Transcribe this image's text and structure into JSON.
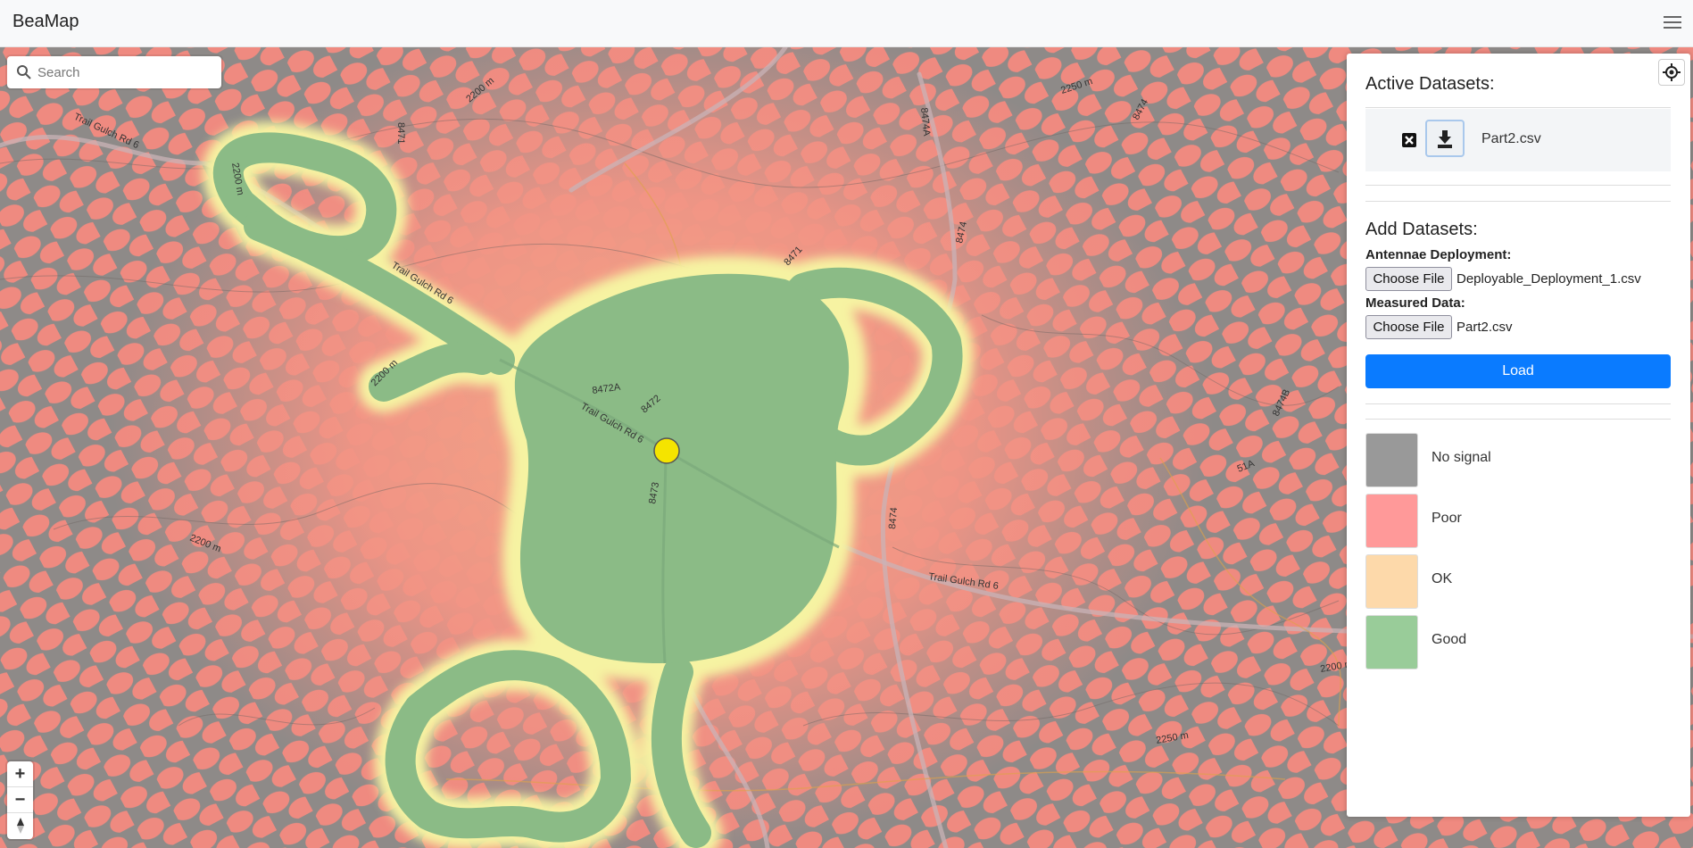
{
  "app": {
    "title": "BeaMap"
  },
  "search": {
    "placeholder": "Search"
  },
  "map": {
    "road_labels": [
      "Trail Gulch Rd 6",
      "Trail Gulch Rd 6",
      "Trail Gulch Rd 6",
      "Trail Gulch Rd 6",
      "8471",
      "8471",
      "8472",
      "8472A",
      "8473",
      "8474",
      "8474",
      "8474A",
      "8474",
      "8474B",
      "51A",
      "2200 m",
      "2200 m",
      "2200 m",
      "2200 m",
      "2250 m",
      "2250 m",
      "2200 m"
    ],
    "marker_color": "#f5e400"
  },
  "panel": {
    "active_title": "Active Datasets:",
    "active_datasets": [
      {
        "name": "Part2.csv"
      }
    ],
    "add_title": "Add Datasets:",
    "antennae_label": "Antennae Deployment:",
    "antennae_file": "Deployable_Deployment_1.csv",
    "measured_label": "Measured Data:",
    "measured_file": "Part2.csv",
    "choose_file": "Choose File",
    "load_label": "Load",
    "legend": [
      {
        "label": "No signal",
        "color": "#999999"
      },
      {
        "label": "Poor",
        "color": "#ff9999"
      },
      {
        "label": "OK",
        "color": "#fdd9aa"
      },
      {
        "label": "Good",
        "color": "#99cc99"
      }
    ]
  },
  "colors": {
    "accent": "#0a7bff",
    "poor": "#f29488",
    "good": "#88ba88",
    "ok": "#f7f0a0"
  }
}
